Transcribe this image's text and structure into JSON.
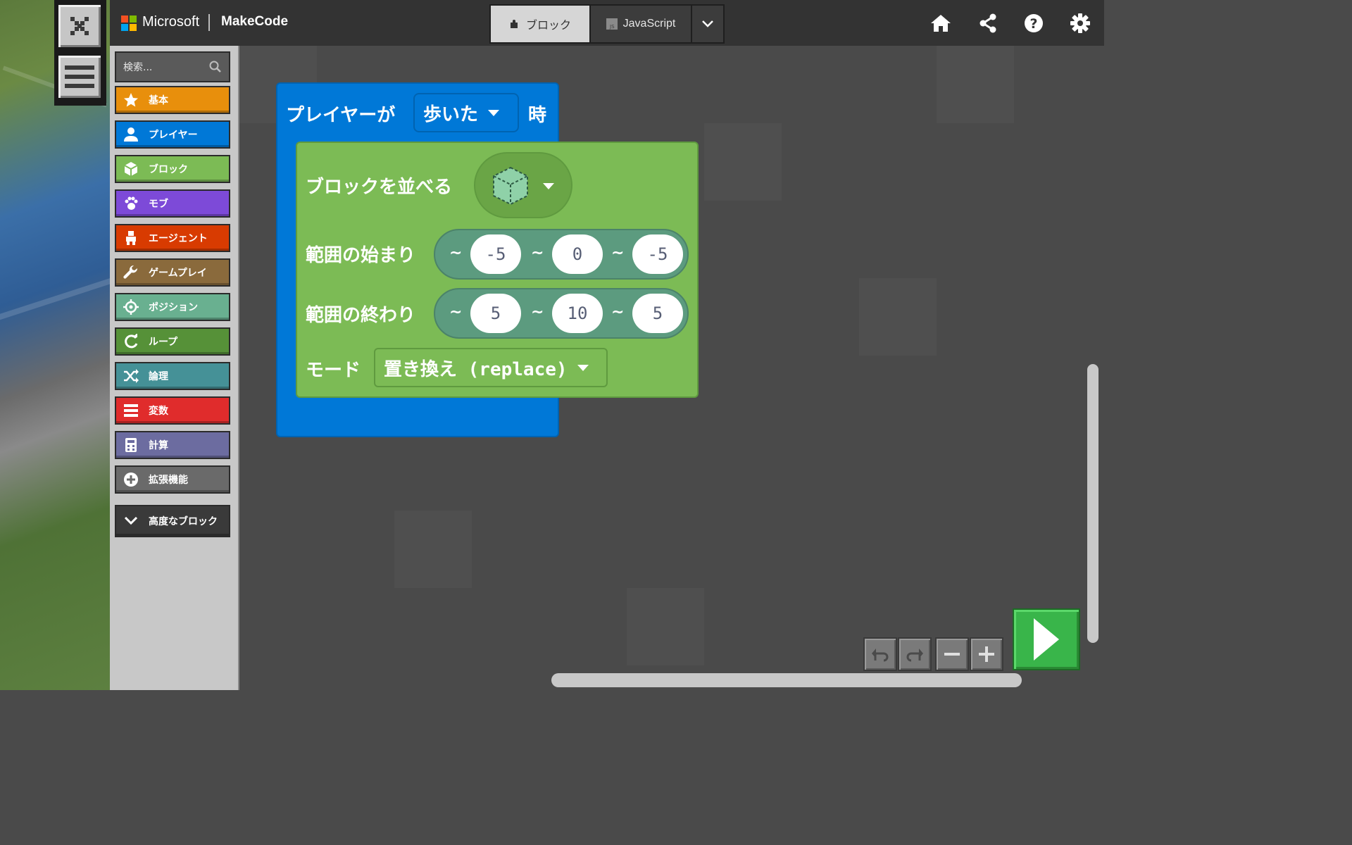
{
  "header": {
    "brand_ms": "Microsoft",
    "brand_app": "MakeCode",
    "tabs": {
      "blocks_label": "ブロック",
      "js_label": "JavaScript"
    },
    "icons": [
      "home-icon",
      "share-icon",
      "help-icon",
      "settings-icon"
    ]
  },
  "toolbox": {
    "search_placeholder": "検索...",
    "categories": [
      {
        "label": "基本",
        "icon": "star-icon",
        "color": "#e88f0c"
      },
      {
        "label": "プレイヤー",
        "icon": "person-icon",
        "color": "#0078d7"
      },
      {
        "label": "ブロック",
        "icon": "cube-icon",
        "color": "#7cbb55"
      },
      {
        "label": "モブ",
        "icon": "paw-icon",
        "color": "#7d4ad8"
      },
      {
        "label": "エージェント",
        "icon": "agent-icon",
        "color": "#d83b01"
      },
      {
        "label": "ゲームプレイ",
        "icon": "wrench-icon",
        "color": "#8a6a3c"
      },
      {
        "label": "ポジション",
        "icon": "crosshair-icon",
        "color": "#69b090"
      },
      {
        "label": "ループ",
        "icon": "loop-icon",
        "color": "#569138"
      },
      {
        "label": "論理",
        "icon": "shuffle-icon",
        "color": "#459197"
      },
      {
        "label": "変数",
        "icon": "list-icon",
        "color": "#e02c2c"
      },
      {
        "label": "計算",
        "icon": "calculator-icon",
        "color": "#6c6ca0"
      },
      {
        "label": "拡張機能",
        "icon": "plus-circle-icon",
        "color": "#6a6a6a"
      }
    ],
    "advanced_label": "高度なブロック"
  },
  "workspace": {
    "event_block": {
      "prefix": "プレイヤーが",
      "dropdown": "歩いた",
      "suffix": "時"
    },
    "fill_block": {
      "title": "ブロックを並べる",
      "from_label": "範囲の始まり",
      "from": {
        "x": "-5",
        "y": "0",
        "z": "-5"
      },
      "to_label": "範囲の終わり",
      "to": {
        "x": "5",
        "y": "10",
        "z": "5"
      },
      "tilde": "~",
      "mode_label": "モード",
      "mode_value": "置き換え (replace)"
    }
  },
  "colors": {
    "header_bg": "#333333",
    "player_blue": "#0078d7",
    "blocks_green": "#7cbb55",
    "position_teal": "#5c9b7f",
    "run_green": "#39b54a"
  }
}
